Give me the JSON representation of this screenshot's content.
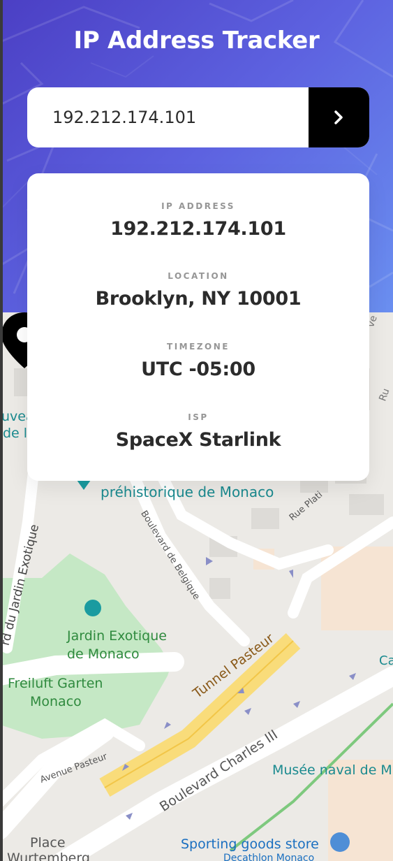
{
  "header": {
    "title": "IP Address Tracker",
    "colors": {
      "gradient_start": "#4b3fc4",
      "gradient_end": "#6a8ff0"
    }
  },
  "search": {
    "value": "192.212.174.101",
    "submit_icon": "chevron-right-icon"
  },
  "info": {
    "ip_label": "IP ADDRESS",
    "ip_value": "192.212.174.101",
    "location_label": "LOCATION",
    "location_value": "Brooklyn, NY 10001",
    "timezone_label": "TIMEZONE",
    "timezone_value": "UTC -05:00",
    "isp_label": "ISP",
    "isp_value": "SpaceX Starlink"
  },
  "map": {
    "marker_icon": "location-pin-icon",
    "labels": {
      "museum_partial_1": "uvea",
      "museum_partial_2": "de l",
      "prehistoric": "préhistorique de Monaco",
      "rue_plati": "Rue Plati",
      "boulevard_belgique": "Boulevard de Belgique",
      "jardin_road": "rd du Jardin Exotique",
      "jardin_exotique_1": "Jardin Exotique",
      "jardin_exotique_2": "de Monaco",
      "freiluft_1": "Freiluft Garten",
      "freiluft_2": "Monaco",
      "tunnel_pasteur": "Tunnel Pasteur",
      "avenue_pasteur": "Avenue Pasteur",
      "boulevard_charles": "Boulevard Charles III",
      "musee_naval": "Musée naval de M",
      "place": "Place",
      "wurtemberg": "Wurtemberg",
      "sporting_goods": "Sporting goods store",
      "decathlon": "Decathlon Monaco",
      "top_right_partial": "ve",
      "right_partial": "Ru",
      "ca_partial": "Ca"
    }
  }
}
